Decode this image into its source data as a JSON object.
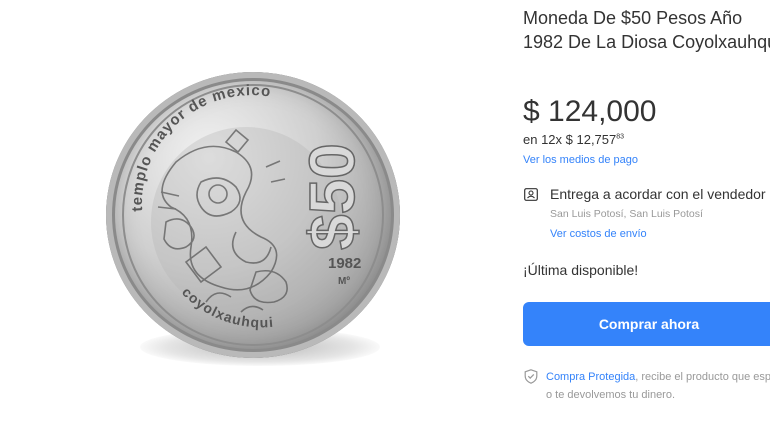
{
  "product": {
    "title": "Moneda De $50 Pesos Año 1982 De La Diosa Coyolxauhqui",
    "price": "$ 124,000",
    "installments_prefix": "en 12x $ 12,757",
    "installments_cents": "83",
    "payment_link": "Ver los medios de pago"
  },
  "coin": {
    "top_legend": "templo mayor de mexico",
    "bottom_legend": "coyolxauhqui",
    "denomination": "$50",
    "year": "1982",
    "mint_mark": "Mº"
  },
  "shipping": {
    "icon": "person-card-icon",
    "title": "Entrega a acordar con el vendedor",
    "location": "San Luis Potosí, San Luis Potosí",
    "link": "Ver costos de envío"
  },
  "stock": {
    "label": "¡Última disponible!"
  },
  "buy": {
    "button_label": "Comprar ahora"
  },
  "protection": {
    "icon": "shield-check-icon",
    "link": "Compra Protegida",
    "text": ", recibe el producto que esperabas o te devolvemos tu dinero."
  },
  "colors": {
    "accent": "#3483fa",
    "text": "#333333",
    "muted": "#999999"
  }
}
